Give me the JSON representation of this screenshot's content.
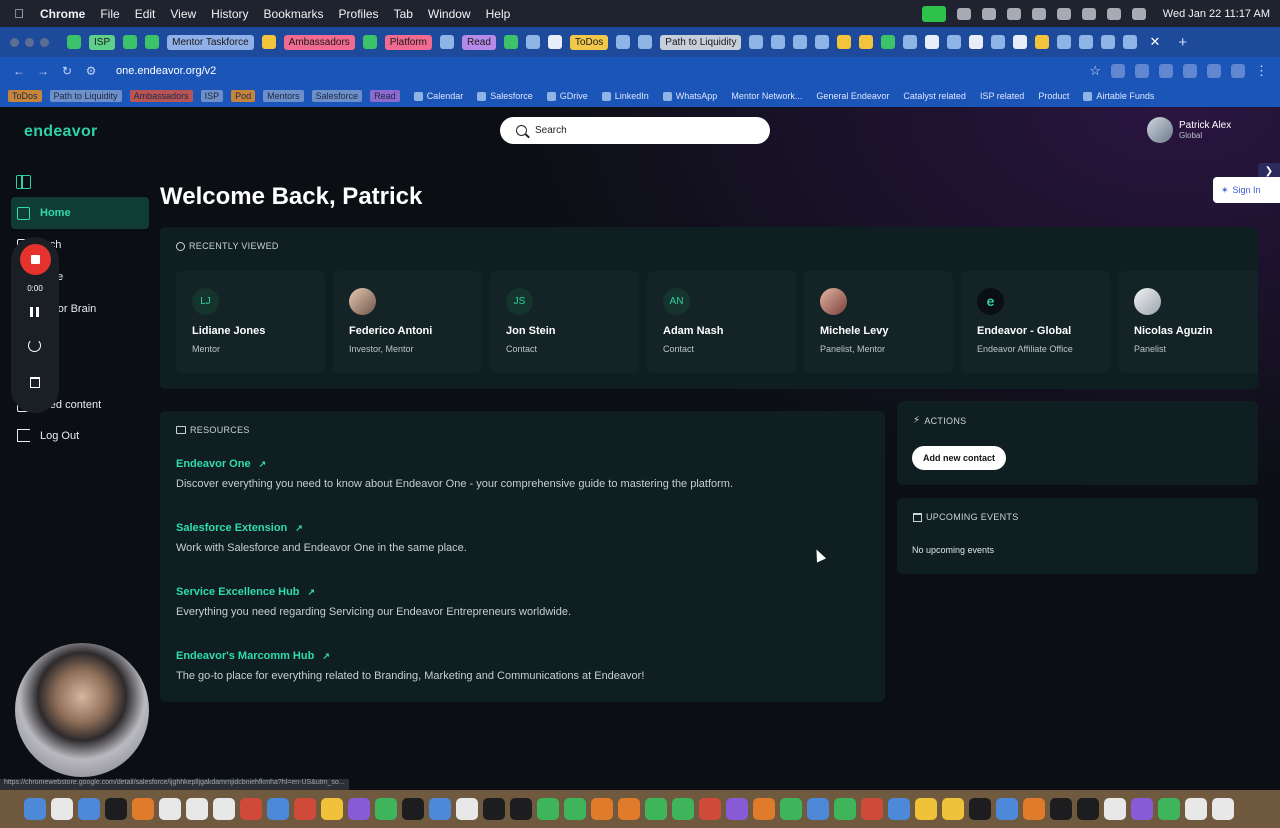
{
  "menubar": {
    "app": "Chrome",
    "items": [
      "File",
      "Edit",
      "View",
      "History",
      "Bookmarks",
      "Profiles",
      "Tab",
      "Window",
      "Help"
    ],
    "clock": "Wed Jan 22  11:17 AM"
  },
  "tabs": {
    "pills": [
      "ISP",
      "Mentor Taskforce",
      "Ambassadors",
      "Platform",
      "Read",
      "ToDos",
      "Path to Liquidity"
    ]
  },
  "address": {
    "url": "one.endeavor.org/v2"
  },
  "bookmarks": {
    "pills": [
      "ToDos",
      "Path to Liquidity",
      "Ambassadors",
      "ISP",
      "Pod",
      "Mentors",
      "Salesforce",
      "Read"
    ],
    "links": [
      "Calendar",
      "Salesforce",
      "GDrive",
      "LinkedIn",
      "WhatsApp",
      "Mentor Network...",
      "General Endeavor",
      "Catalyst related",
      "ISP related",
      "Product",
      "Airtable Funds"
    ]
  },
  "app": {
    "logo": "endeavor",
    "search_placeholder": "Search",
    "user": {
      "name": "Patrick Alex",
      "region": "Global"
    },
    "signin": "Sign In",
    "welcome": "Welcome Back, Patrick",
    "nav": [
      {
        "label": "Home",
        "icon": "home-icon"
      },
      {
        "label": "arch",
        "icon": "search-icon"
      },
      {
        "label": "eline",
        "icon": "pipeline-icon"
      },
      {
        "label": "eavor Brain",
        "icon": "brain-icon"
      },
      {
        "label": "els",
        "icon": "panels-icon"
      },
      {
        "label": "s",
        "icon": "lists-icon"
      },
      {
        "label": "ared content",
        "icon": "share-icon"
      }
    ],
    "logout": "Log Out",
    "recorder": {
      "time": "0:00"
    }
  },
  "recently_viewed": {
    "title": "RECENTLY VIEWED",
    "items": [
      {
        "initials": "LJ",
        "name": "Lidiane Jones",
        "role": "Mentor"
      },
      {
        "initials": "",
        "name": "Federico Antoni",
        "role": "Investor, Mentor"
      },
      {
        "initials": "JS",
        "name": "Jon Stein",
        "role": "Contact"
      },
      {
        "initials": "AN",
        "name": "Adam Nash",
        "role": "Contact"
      },
      {
        "initials": "",
        "name": "Michele Levy",
        "role": "Panelist, Mentor"
      },
      {
        "initials": "e",
        "name": "Endeavor - Global",
        "role": "Endeavor Affiliate Office"
      },
      {
        "initials": "",
        "name": "Nicolas Aguzin",
        "role": "Panelist"
      }
    ]
  },
  "resources": {
    "title": "RESOURCES",
    "items": [
      {
        "title": "Endeavor One",
        "desc": "Discover everything you need to know about Endeavor One - your comprehensive guide to mastering the platform."
      },
      {
        "title": "Salesforce Extension",
        "desc": "Work with Salesforce and Endeavor One in the same place."
      },
      {
        "title": "Service Excellence Hub",
        "desc": "Everything you need regarding Servicing our Endeavor Entrepreneurs worldwide."
      },
      {
        "title": "Endeavor's Marcomm Hub",
        "desc": "The go-to place for everything related to Branding, Marketing and Communications at Endeavor!"
      }
    ]
  },
  "actions": {
    "title": "ACTIONS",
    "add_contact": "Add new contact"
  },
  "events": {
    "title": "UPCOMING EVENTS",
    "empty": "No upcoming events"
  },
  "status_url": "https://chromewebstore.google.com/detail/salesforce/ijghhkeplljgakdamrnjidcbniehfkmha?hl=en-US&utm_so...",
  "colors": {
    "accent": "#30dcae",
    "panel": "#0f1e21",
    "background": "#0b0f14"
  }
}
